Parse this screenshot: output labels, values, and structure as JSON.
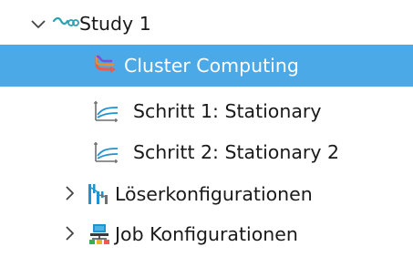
{
  "tree": {
    "items": [
      {
        "label": "Study 1",
        "icon": "study-icon",
        "expanded": true
      },
      {
        "label": "Cluster Computing",
        "icon": "cluster-computing-icon",
        "selected": true
      },
      {
        "label": "Schritt 1: Stationary",
        "icon": "stationary-step-icon"
      },
      {
        "label": "Schritt 2: Stationary 2",
        "icon": "stationary-step-icon"
      },
      {
        "label": "Löserkonfigurationen",
        "icon": "solver-configurations-icon",
        "expanded": false
      },
      {
        "label": "Job Konfigurationen",
        "icon": "job-configurations-icon",
        "expanded": false
      }
    ]
  },
  "colors": {
    "selection": "#4aa9e6",
    "text": "#1a1a1a",
    "selected_text": "#ffffff"
  }
}
